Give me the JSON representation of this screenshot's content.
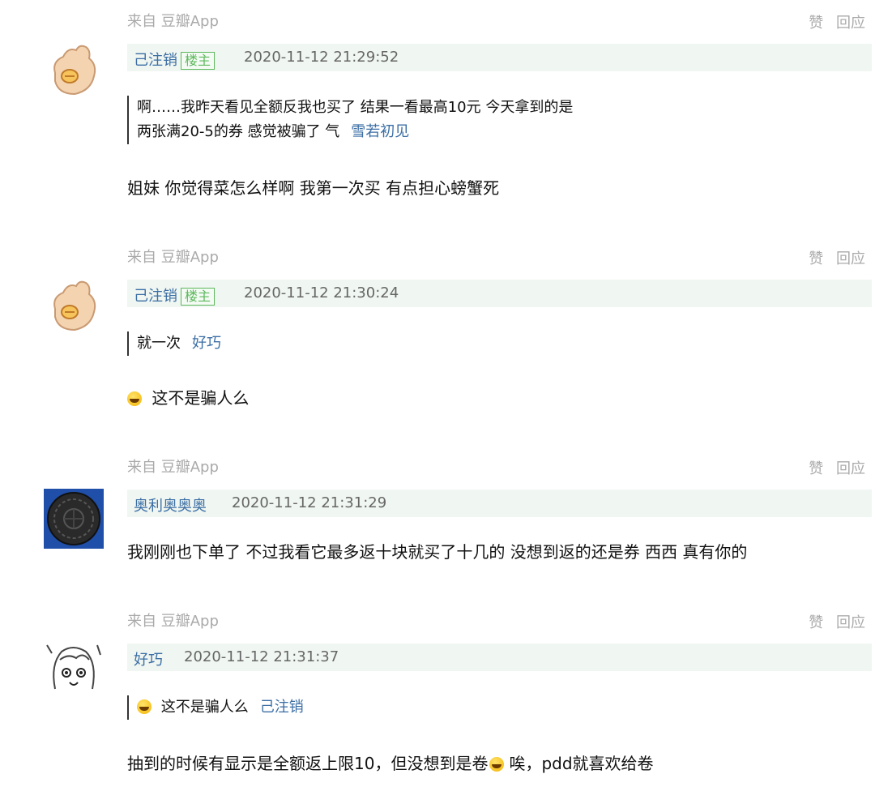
{
  "comments": [
    {
      "source": "来自 豆瓣App",
      "like": "赞",
      "reply": "回应",
      "user": "己注销",
      "badge": "楼主",
      "time": "2020-11-12 21:29:52",
      "quote_line1": "啊……我昨天看见全额反我也买了 结果一看最高10元 今天拿到的是",
      "quote_line2": "两张满20-5的券 感觉被骗了 气",
      "quote_author": "雪若初见",
      "text": "姐妹 你觉得菜怎么样啊 我第一次买 有点担心螃蟹死"
    },
    {
      "source": "来自 豆瓣App",
      "like": "赞",
      "reply": "回应",
      "user": "己注销",
      "badge": "楼主",
      "time": "2020-11-12 21:30:24",
      "quote_line1": "就一次",
      "quote_author": "好巧",
      "text": "这不是骗人么"
    },
    {
      "source": "来自 豆瓣App",
      "like": "赞",
      "reply": "回应",
      "user": "奥利奥奥奥",
      "time": "2020-11-12 21:31:29",
      "text": "我刚刚也下单了 不过我看它最多返十块就买了十几的 没想到返的还是券 西西 真有你的"
    },
    {
      "source": "来自 豆瓣App",
      "like": "赞",
      "reply": "回应",
      "user": "好巧",
      "time": "2020-11-12 21:31:37",
      "quote_line1": "这不是骗人么",
      "quote_author": "己注销",
      "text_a": "抽到的时候有显示是全额返上限10，但没想到是卷",
      "text_b": "唉，pdd就喜欢给卷"
    }
  ],
  "icons": {
    "ok_hand": "ok-hand-icon",
    "oreo": "oreo-avatar",
    "anime": "anime-avatar",
    "laugh": "laughing-emoji-icon"
  },
  "colors": {
    "link": "#3b6ea5",
    "header_bg": "#f0f6f1",
    "badge": "#5cb85c",
    "muted": "#aaaaaa"
  }
}
